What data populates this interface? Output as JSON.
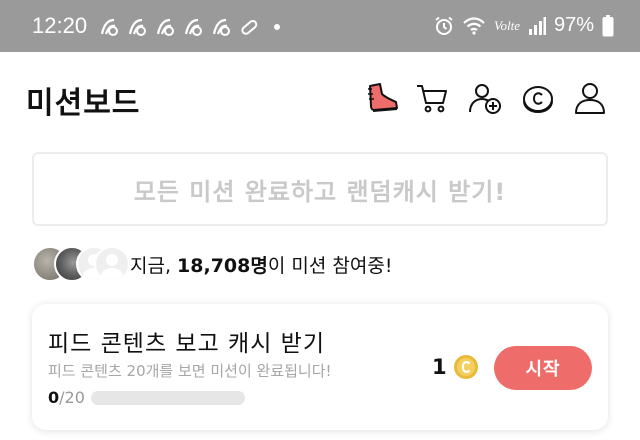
{
  "status_bar": {
    "time": "12:20",
    "volte": "Volte",
    "battery": "97%"
  },
  "header": {
    "title": "미션보드",
    "icons": [
      "shoe-icon",
      "cart-icon",
      "add-friend-icon",
      "coin-icon",
      "profile-icon"
    ]
  },
  "banner": {
    "text": "모든 미션 완료하고 랜덤캐시 받기!"
  },
  "participants": {
    "prefix": "지금, ",
    "count": "18,708명",
    "suffix": "이 미션 참여중!"
  },
  "mission": {
    "title": "피드 콘텐츠 보고 캐시 받기",
    "description": "피드 콘텐츠 20개를 보면 미션이 완료됩니다!",
    "progress_done": "0",
    "progress_total": "/20",
    "progress_fraction": 0,
    "reward": "1",
    "start_label": "시작"
  },
  "colors": {
    "accent": "#ee6d6a",
    "coin": "#e8b93a",
    "status_bar": "#9a9a9a"
  }
}
